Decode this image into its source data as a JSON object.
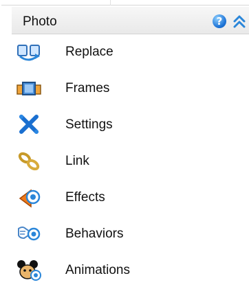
{
  "panel": {
    "title": "Photo",
    "help_symbol": "?",
    "icons": {
      "help": "help-icon",
      "collapse": "double-chevron-up-icon"
    }
  },
  "menu": {
    "items": [
      {
        "label": "Replace",
        "icon": "replace-icon"
      },
      {
        "label": "Frames",
        "icon": "frames-icon"
      },
      {
        "label": "Settings",
        "icon": "settings-icon"
      },
      {
        "label": "Link",
        "icon": "link-icon"
      },
      {
        "label": "Effects",
        "icon": "effects-icon"
      },
      {
        "label": "Behaviors",
        "icon": "behaviors-icon"
      },
      {
        "label": "Animations",
        "icon": "animations-icon"
      }
    ]
  },
  "colors": {
    "accent": "#1d73d6",
    "header_bg": "#eeeeee",
    "text": "#111111"
  }
}
